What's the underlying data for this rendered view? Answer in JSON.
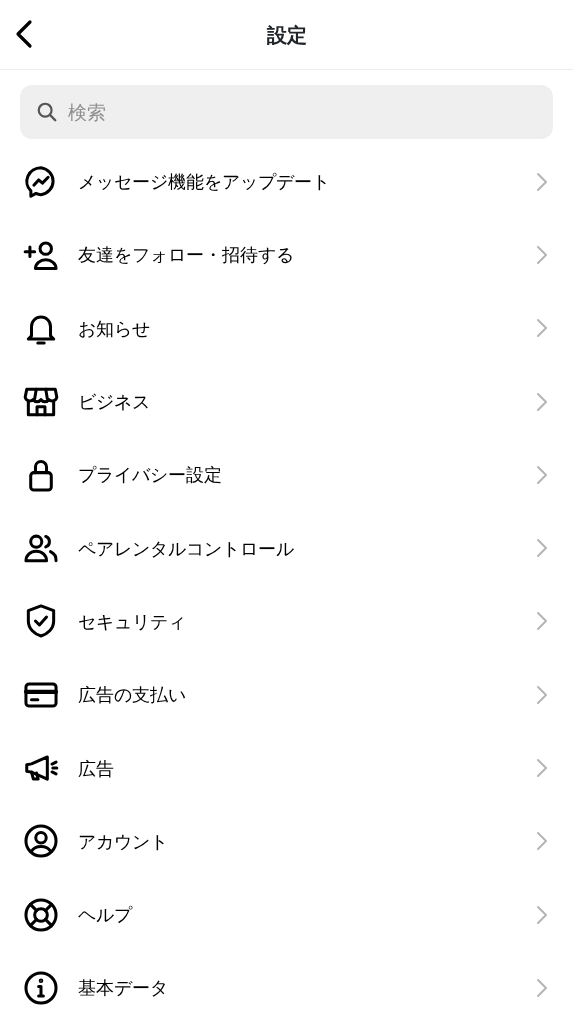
{
  "header": {
    "title": "設定"
  },
  "search": {
    "placeholder": "検索"
  },
  "items": [
    {
      "label": "メッセージ機能をアップデート"
    },
    {
      "label": "友達をフォロー・招待する"
    },
    {
      "label": "お知らせ"
    },
    {
      "label": "ビジネス"
    },
    {
      "label": "プライバシー設定"
    },
    {
      "label": "ペアレンタルコントロール"
    },
    {
      "label": "セキュリティ"
    },
    {
      "label": "広告の支払い"
    },
    {
      "label": "広告"
    },
    {
      "label": "アカウント"
    },
    {
      "label": "ヘルプ"
    },
    {
      "label": "基本データ"
    }
  ]
}
